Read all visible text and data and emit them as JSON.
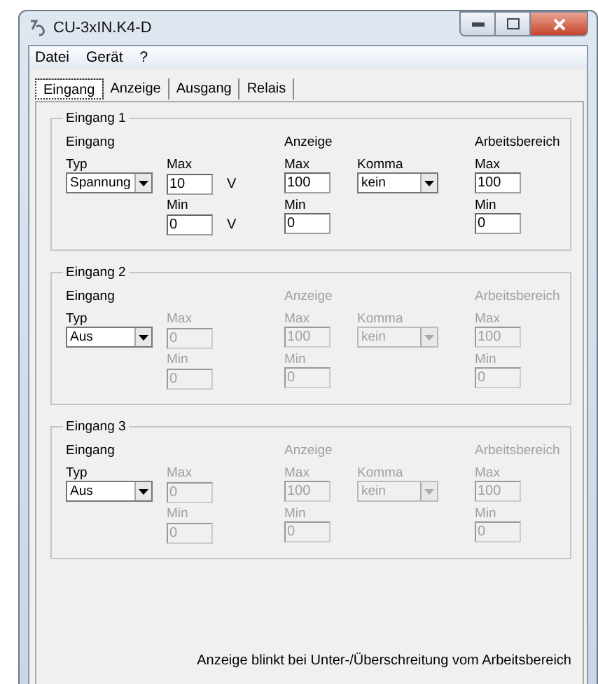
{
  "window": {
    "title": "CU-3xIN.K4-D"
  },
  "menu": [
    "Datei",
    "Gerät",
    "?"
  ],
  "tabs": [
    {
      "label": "Eingang",
      "selected": true
    },
    {
      "label": "Anzeige",
      "selected": false
    },
    {
      "label": "Ausgang",
      "selected": false
    },
    {
      "label": "Relais",
      "selected": false
    }
  ],
  "groups": [
    {
      "title": "Eingang 1",
      "disabled": false,
      "headings": [
        "Eingang",
        "Anzeige",
        "Arbeitsbereich"
      ],
      "typ": {
        "label": "Typ",
        "value": "Spannung"
      },
      "input_max": {
        "label": "Max",
        "value": "10",
        "unit": "V"
      },
      "input_min": {
        "label": "Min",
        "value": "0",
        "unit": "V"
      },
      "anzeige_max": {
        "label": "Max",
        "value": "100"
      },
      "komma": {
        "label": "Komma",
        "value": "kein"
      },
      "anzeige_min": {
        "label": "Min",
        "value": "0"
      },
      "bereich_max": {
        "label": "Max",
        "value": "100"
      },
      "bereich_min": {
        "label": "Min",
        "value": "0"
      }
    },
    {
      "title": "Eingang 2",
      "disabled": true,
      "headings": [
        "Eingang",
        "Anzeige",
        "Arbeitsbereich"
      ],
      "typ": {
        "label": "Typ",
        "value": "Aus"
      },
      "input_max": {
        "label": "Max",
        "value": "0"
      },
      "input_min": {
        "label": "Min",
        "value": "0"
      },
      "anzeige_max": {
        "label": "Max",
        "value": "100"
      },
      "komma": {
        "label": "Komma",
        "value": "kein"
      },
      "anzeige_min": {
        "label": "Min",
        "value": "0"
      },
      "bereich_max": {
        "label": "Max",
        "value": "100"
      },
      "bereich_min": {
        "label": "Min",
        "value": "0"
      }
    },
    {
      "title": "Eingang 3",
      "disabled": true,
      "headings": [
        "Eingang",
        "Anzeige",
        "Arbeitsbereich"
      ],
      "typ": {
        "label": "Typ",
        "value": "Aus"
      },
      "input_max": {
        "label": "Max",
        "value": "0"
      },
      "input_min": {
        "label": "Min",
        "value": "0"
      },
      "anzeige_max": {
        "label": "Max",
        "value": "100"
      },
      "komma": {
        "label": "Komma",
        "value": "kein"
      },
      "anzeige_min": {
        "label": "Min",
        "value": "0"
      },
      "bereich_max": {
        "label": "Max",
        "value": "100"
      },
      "bereich_min": {
        "label": "Min",
        "value": "0"
      }
    }
  ],
  "footer_note": "Anzeige blinkt bei Unter-/Überschreitung vom Arbeitsbereich"
}
